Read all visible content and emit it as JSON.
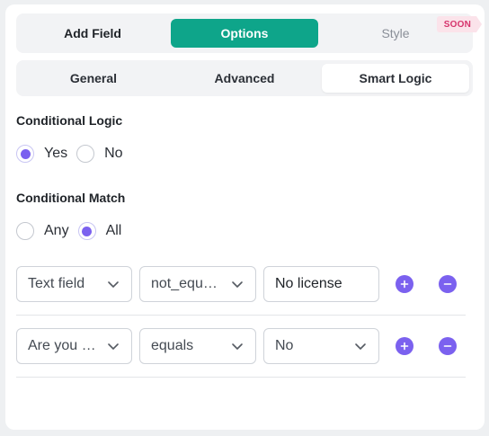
{
  "top_tabs": [
    {
      "label": "Add Field"
    },
    {
      "label": "Options"
    },
    {
      "label": "Style",
      "badge": "SOON"
    }
  ],
  "sub_tabs": [
    {
      "label": "General"
    },
    {
      "label": "Advanced"
    },
    {
      "label": "Smart Logic"
    }
  ],
  "conditional_logic": {
    "label": "Conditional Logic",
    "options": [
      "Yes",
      "No"
    ],
    "selected": "Yes"
  },
  "conditional_match": {
    "label": "Conditional Match",
    "options": [
      "Any",
      "All"
    ],
    "selected": "All"
  },
  "rules": [
    {
      "field": "Text field",
      "operator": "not_equ…",
      "value": "No license",
      "value_type": "text"
    },
    {
      "field": "Are you …",
      "operator": "equals",
      "value": "No",
      "value_type": "select"
    }
  ],
  "colors": {
    "accent": "#0ea58a",
    "radio_and_icons": "#7b61ef",
    "badge_bg": "#fbe3ea",
    "badge_text": "#d6336c"
  },
  "icons": {
    "add": "plus-circle-icon",
    "remove": "minus-circle-icon",
    "dropdown": "chevron-down-icon"
  }
}
